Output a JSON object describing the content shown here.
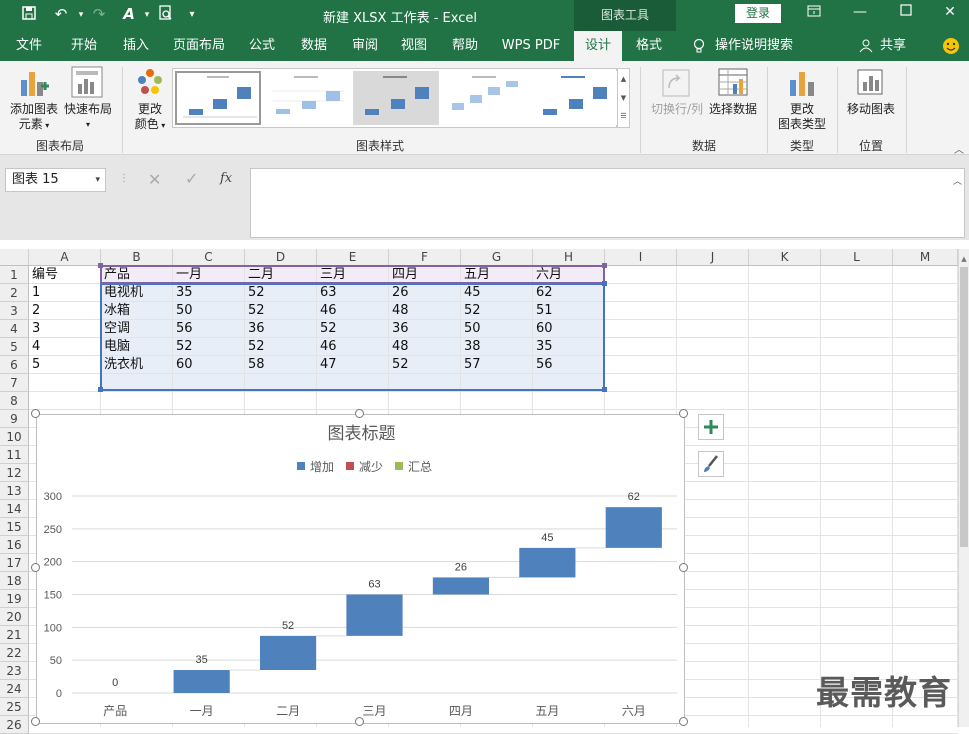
{
  "window": {
    "title": "新建 XLSX 工作表  -  Excel",
    "context_tools": "图表工具",
    "login": "登录"
  },
  "tabs": [
    "文件",
    "开始",
    "插入",
    "页面布局",
    "公式",
    "数据",
    "审阅",
    "视图",
    "帮助",
    "WPS PDF",
    "设计",
    "格式"
  ],
  "active_tab": "设计",
  "tellme": "操作说明搜索",
  "share": "共享",
  "ribbon": {
    "add_element": [
      "添加图表",
      "元素"
    ],
    "quick_layout": "快速布局",
    "change_color": [
      "更改",
      "颜色"
    ],
    "switch_row_col": "切换行/列",
    "select_data": "选择数据",
    "change_type": [
      "更改",
      "图表类型"
    ],
    "move_chart": "移动图表",
    "groups": {
      "layout": "图表布局",
      "styles": "图表样式",
      "data": "数据",
      "type": "类型",
      "location": "位置"
    }
  },
  "formula_bar": {
    "name_box": "图表 15",
    "fx": "fx",
    "value": ""
  },
  "columns": [
    "A",
    "B",
    "C",
    "D",
    "E",
    "F",
    "G",
    "H",
    "I",
    "J",
    "K",
    "L",
    "M"
  ],
  "rows": [
    "1",
    "2",
    "3",
    "4",
    "5",
    "6",
    "7",
    "8",
    "9",
    "10",
    "11",
    "12",
    "13",
    "14",
    "15",
    "16",
    "17",
    "18",
    "19",
    "20",
    "21",
    "22",
    "23",
    "24",
    "25",
    "26"
  ],
  "table": {
    "header": [
      "编号",
      "产品",
      "一月",
      "二月",
      "三月",
      "四月",
      "五月",
      "六月"
    ],
    "data": [
      [
        "1",
        "电视机",
        "35",
        "52",
        "63",
        "26",
        "45",
        "62"
      ],
      [
        "2",
        "冰箱",
        "50",
        "52",
        "46",
        "48",
        "52",
        "51"
      ],
      [
        "3",
        "空调",
        "56",
        "36",
        "52",
        "36",
        "50",
        "60"
      ],
      [
        "4",
        "电脑",
        "52",
        "52",
        "46",
        "48",
        "38",
        "35"
      ],
      [
        "5",
        "洗衣机",
        "60",
        "58",
        "47",
        "52",
        "57",
        "56"
      ]
    ]
  },
  "chart_data": {
    "type": "waterfall",
    "title": "图表标题",
    "legend": [
      "增加",
      "减少",
      "汇总"
    ],
    "legend_colors": [
      "#4f81bd",
      "#c0504d",
      "#9bbb59"
    ],
    "legend_position": "top",
    "categories": [
      "产品",
      "一月",
      "二月",
      "三月",
      "四月",
      "五月",
      "六月"
    ],
    "values": [
      0,
      35,
      52,
      63,
      26,
      45,
      62
    ],
    "labels": [
      "0",
      "35",
      "52",
      "63",
      "26",
      "45",
      "62"
    ],
    "ylim": [
      0,
      300
    ],
    "yticks": [
      "0",
      "50",
      "100",
      "150",
      "200",
      "250",
      "300"
    ],
    "bar_color": "#4f81bd",
    "grid": true
  },
  "watermark": "最需教育"
}
